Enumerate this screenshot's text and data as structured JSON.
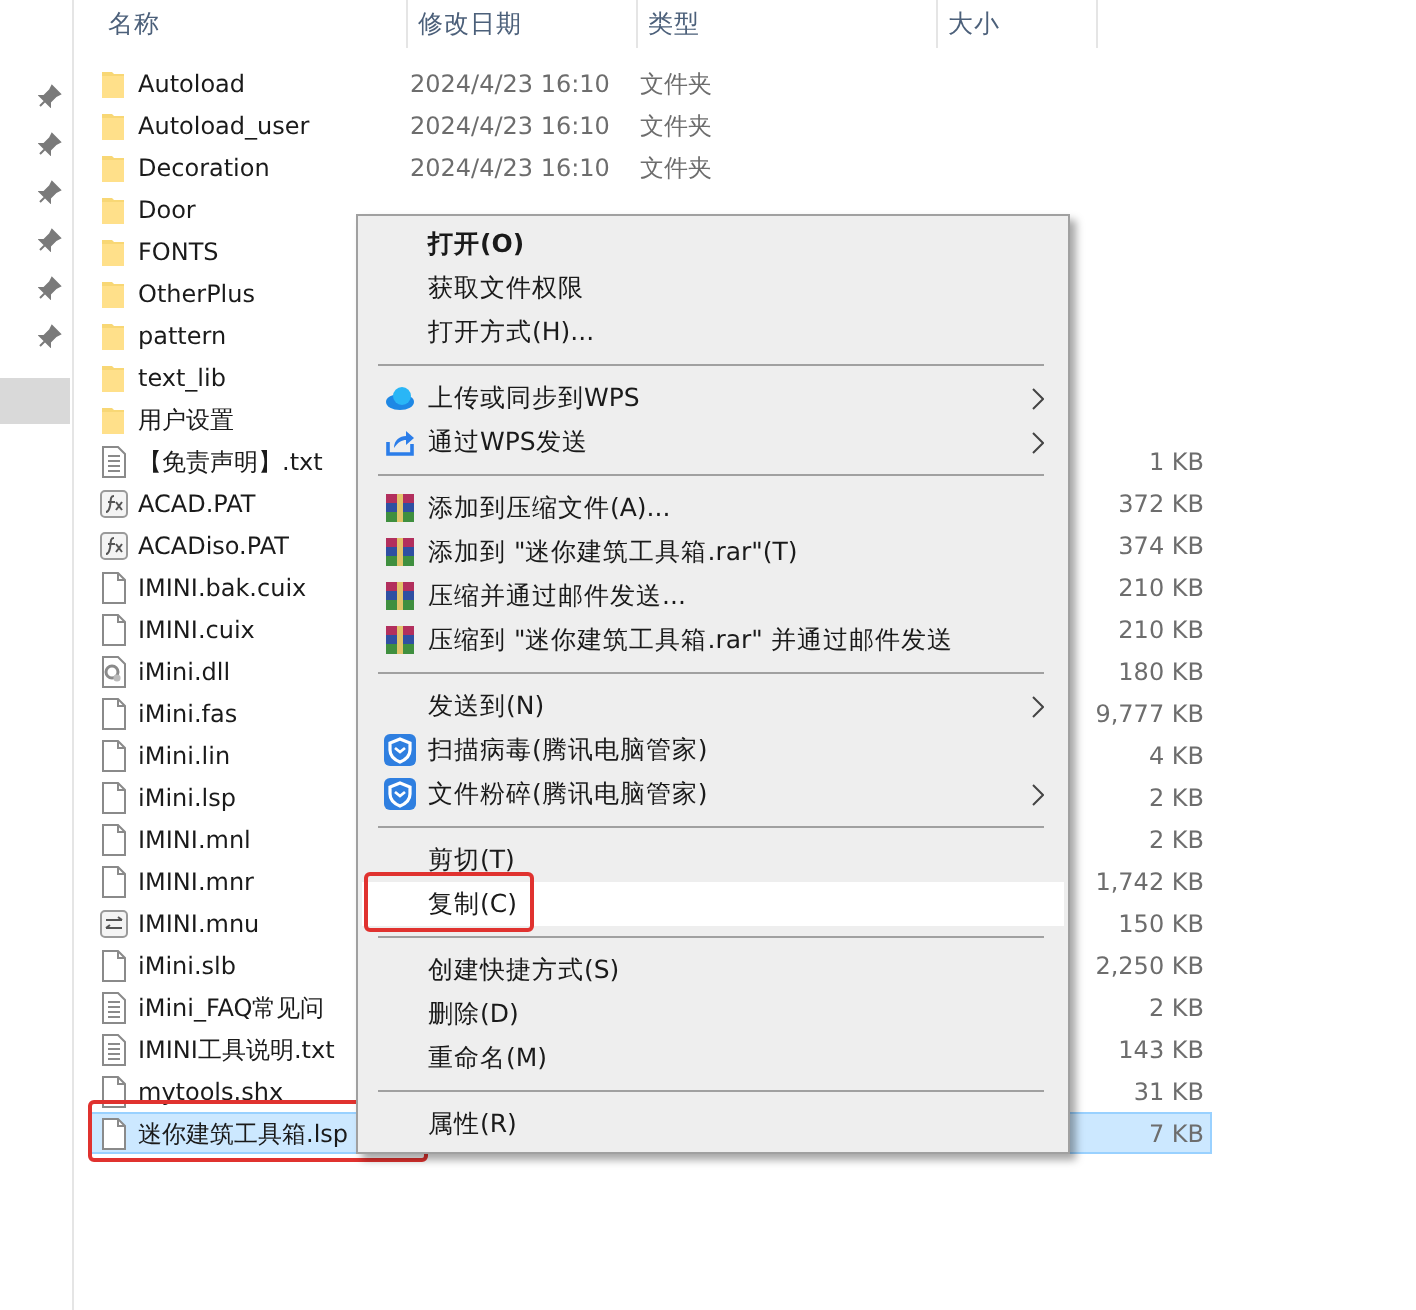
{
  "columns": [
    "名称",
    "修改日期",
    "类型",
    "大小"
  ],
  "nav": {
    "selected_slot": true
  },
  "files": [
    {
      "name": "Autoload",
      "date": "2024/4/23 16:10",
      "type": "文件夹",
      "kind": "folder",
      "selected": false
    },
    {
      "name": "Autoload_user",
      "date": "2024/4/23 16:10",
      "type": "文件夹",
      "kind": "folder",
      "selected": false
    },
    {
      "name": "Decoration",
      "date": "2024/4/23 16:10",
      "type": "文件夹",
      "kind": "folder",
      "selected": false
    },
    {
      "name": "Door",
      "kind": "folder",
      "selected": false
    },
    {
      "name": "FONTS",
      "kind": "folder",
      "selected": false
    },
    {
      "name": "OtherPlus",
      "kind": "folder",
      "selected": false
    },
    {
      "name": "pattern",
      "kind": "folder",
      "selected": false
    },
    {
      "name": "text_lib",
      "kind": "folder",
      "selected": false
    },
    {
      "name": "用户设置",
      "kind": "folder",
      "selected": false
    },
    {
      "name": "【免责声明】.txt",
      "size": "1 KB",
      "kind": "text",
      "selected": false
    },
    {
      "name": "ACAD.PAT",
      "size": "372 KB",
      "kind": "pattern",
      "selected": false
    },
    {
      "name": "ACADiso.PAT",
      "size": "374 KB",
      "kind": "pattern",
      "selected": false
    },
    {
      "name": "IMINI.bak.cuix",
      "size": "210 KB",
      "kind": "file",
      "selected": false
    },
    {
      "name": "IMINI.cuix",
      "size": "210 KB",
      "kind": "file",
      "selected": false
    },
    {
      "name": "iMini.dll",
      "size": "180 KB",
      "kind": "library",
      "selected": false
    },
    {
      "name": "iMini.fas",
      "size": "9,777 KB",
      "kind": "file",
      "selected": false
    },
    {
      "name": "iMini.lin",
      "size": "4 KB",
      "kind": "file",
      "selected": false
    },
    {
      "name": "iMini.lsp",
      "size": "2 KB",
      "kind": "file",
      "selected": false
    },
    {
      "name": "IMINI.mnl",
      "size": "2 KB",
      "kind": "file",
      "selected": false
    },
    {
      "name": "IMINI.mnr",
      "size": "1,742 KB",
      "kind": "file",
      "selected": false
    },
    {
      "name": "IMINI.mnu",
      "size": "150 KB",
      "kind": "menu",
      "selected": false
    },
    {
      "name": "iMini.slb",
      "size": "2,250 KB",
      "kind": "file",
      "selected": false
    },
    {
      "name": "iMini_FAQ常见问",
      "size": "2 KB",
      "kind": "text",
      "selected": false
    },
    {
      "name": "IMINI工具说明.txt",
      "size": "143 KB",
      "kind": "text",
      "selected": false
    },
    {
      "name": "mytools.shx",
      "size": "31 KB",
      "kind": "file",
      "selected": false
    },
    {
      "name": "迷你建筑工具箱.lsp",
      "size": "7 KB",
      "kind": "file",
      "selected": true,
      "highlighted": true
    }
  ],
  "context_menu": [
    {
      "kind": "plain",
      "label": "打开(O)",
      "default": true,
      "selected": false
    },
    {
      "kind": "plain",
      "label": "获取文件权限",
      "selected": false
    },
    {
      "kind": "plain",
      "label": "打开方式(H)...",
      "selected": false
    },
    {
      "kind": "separator"
    },
    {
      "kind": "cloud",
      "label": "上传或同步到WPS",
      "submenu": true,
      "selected": false
    },
    {
      "kind": "share",
      "label": "通过WPS发送",
      "submenu": true,
      "selected": false
    },
    {
      "kind": "separator"
    },
    {
      "kind": "archive",
      "label": "添加到压缩文件(A)...",
      "selected": false
    },
    {
      "kind": "archive",
      "label": "添加到 \"迷你建筑工具箱.rar\"(T)",
      "selected": false
    },
    {
      "kind": "archive",
      "label": "压缩并通过邮件发送...",
      "selected": false
    },
    {
      "kind": "archive",
      "label": "压缩到 \"迷你建筑工具箱.rar\" 并通过邮件发送",
      "selected": false
    },
    {
      "kind": "separator"
    },
    {
      "kind": "plain",
      "label": "发送到(N)",
      "submenu": true,
      "selected": false
    },
    {
      "kind": "shield",
      "label": "扫描病毒(腾讯电脑管家)",
      "selected": false
    },
    {
      "kind": "shield",
      "label": "文件粉碎(腾讯电脑管家)",
      "submenu": true,
      "selected": false
    },
    {
      "kind": "separator"
    },
    {
      "kind": "plain",
      "label": "剪切(T)",
      "selected": false
    },
    {
      "kind": "plain",
      "label": "复制(C)",
      "selected": true,
      "highlighted": true
    },
    {
      "kind": "separator"
    },
    {
      "kind": "plain",
      "label": "创建快捷方式(S)",
      "selected": false
    },
    {
      "kind": "plain",
      "label": "删除(D)",
      "selected": false
    },
    {
      "kind": "plain",
      "label": "重命名(M)",
      "selected": false
    },
    {
      "kind": "separator"
    },
    {
      "kind": "plain",
      "label": "属性(R)",
      "selected": false
    }
  ]
}
